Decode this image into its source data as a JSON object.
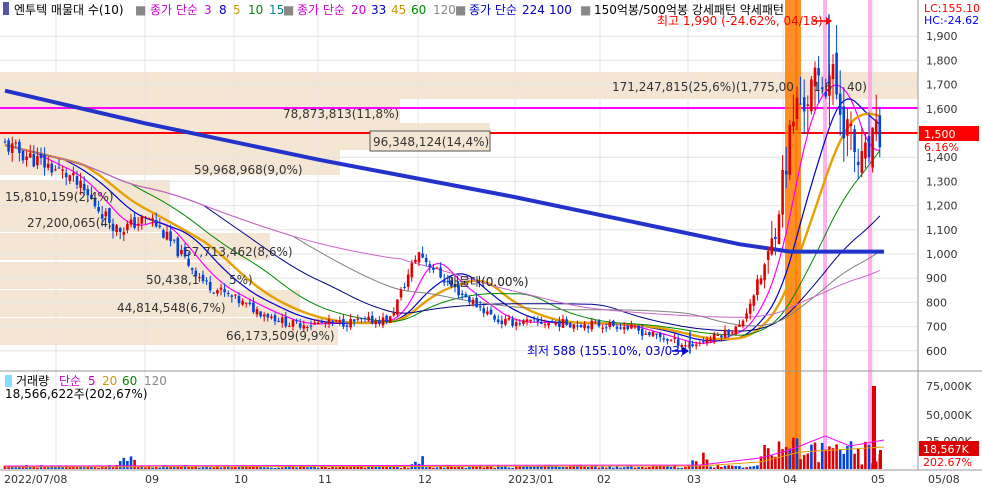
{
  "price_legend": {
    "stock": "엔투텍 매물대 수(10)",
    "ma_group1": "종가 단순",
    "ma_group1_periods": [
      "3",
      "8",
      "5",
      "10",
      "15"
    ],
    "ma_group2": "종가 단순",
    "ma_group2_periods": [
      "20",
      "33",
      "45",
      "60",
      "120"
    ],
    "ma_group3": "종가 단순",
    "ma_group3_periods": [
      "224",
      "100"
    ],
    "pattern": "150억봉/500억봉 강세패턴 약세패턴"
  },
  "price_corner": {
    "lc": "LC:155.10",
    "hc": "HC:-24.62"
  },
  "annotations": {
    "high": "최고 1,990 (-24.62%, 04/18)",
    "low": "최저 588 (155.10%, 03/03)",
    "crosshair": "매물대(0.00%)",
    "current_price": "1,500",
    "current_change": "6.16%"
  },
  "volume_profile": [
    {
      "label": "171,247,815(25,6%)(1,775,00",
      "suffix": "1,6",
      "suffix2": "40)"
    },
    {
      "label": "78,873,813(11,8%)"
    },
    {
      "label": "96,348,124(14,4%)"
    },
    {
      "label": "59,968,968(9,0%)"
    },
    {
      "label": "15,810,159(2,4%)"
    },
    {
      "label": "27,200,065(4,"
    },
    {
      "label": "57,713,462(8,6%)"
    },
    {
      "label": "50,438,1",
      "suffix": "5%)"
    },
    {
      "label": "44,814,548(6,7%)"
    },
    {
      "label": "66,173,509(9,9%)"
    }
  ],
  "price_axis": [
    "1,900",
    "1,800",
    "1,700",
    "1,600",
    "1,500",
    "1,400",
    "1,300",
    "1,200",
    "1,100",
    "1,000",
    "900",
    "800",
    "700",
    "600"
  ],
  "volume_legend": {
    "title": "거래량",
    "ma": "단순",
    "periods": [
      "5",
      "20",
      "60",
      "120"
    ],
    "current": "18,566,622주(202,67%)"
  },
  "volume_axis": [
    "75,000K",
    "50,000K",
    "25,000K"
  ],
  "volume_badge": {
    "value": "18,567K",
    "pct": "202.67%"
  },
  "date_axis": [
    "2022/07/08",
    "09",
    "10",
    "11",
    "12",
    "2023/01",
    "02",
    "03",
    "04",
    "05",
    "05/08"
  ],
  "colors": {
    "price_line": "#0000ff",
    "rising": "#e00000",
    "falling": "#0044dd",
    "ma224": "#2233cc",
    "magenta_line": "#ff00ff",
    "red_line": "#ff0000",
    "profile_bg": "#f5e6d3",
    "volume_badge": "#dd0000"
  },
  "chart_data": {
    "type": "candlestick",
    "x": [
      "2022/07/08",
      "09",
      "10",
      "11",
      "12",
      "2023/01",
      "02",
      "03",
      "04",
      "05",
      "05/08"
    ],
    "ylim": [
      550,
      2000
    ],
    "close_path": [
      {
        "x": "2022/07/08",
        "y": 1450
      },
      {
        "x": "2022/08",
        "y": 1320
      },
      {
        "x": "2022/08",
        "y": 1100
      },
      {
        "x": "2022/09",
        "y": 1150
      },
      {
        "x": "2022/09",
        "y": 880
      },
      {
        "x": "2022/10",
        "y": 780
      },
      {
        "x": "2022/10",
        "y": 710
      },
      {
        "x": "2022/11",
        "y": 715
      },
      {
        "x": "2022/11",
        "y": 730
      },
      {
        "x": "2022/12",
        "y": 1010
      },
      {
        "x": "2022/12",
        "y": 870
      },
      {
        "x": "2023/01",
        "y": 720
      },
      {
        "x": "2023/01",
        "y": 715
      },
      {
        "x": "2023/02",
        "y": 705
      },
      {
        "x": "2023/03",
        "y": 620
      },
      {
        "x": "2023/03",
        "y": 700
      },
      {
        "x": "2023/04",
        "y": 1000
      },
      {
        "x": "2023/04",
        "y": 1600
      },
      {
        "x": "2023/04",
        "y": 1750
      },
      {
        "x": "2023/05",
        "y": 1350
      },
      {
        "x": "05/08",
        "y": 1500
      }
    ],
    "ma224": [
      {
        "x": "2022/07/08",
        "y": 1675
      },
      {
        "x": "2022/09",
        "y": 1540
      },
      {
        "x": "2022/11",
        "y": 1390
      },
      {
        "x": "2023/01",
        "y": 1235
      },
      {
        "x": "2023/03",
        "y": 1040
      },
      {
        "x": "2023/04",
        "y": 1010
      },
      {
        "x": "05/08",
        "y": 1010
      }
    ],
    "high": 1990,
    "low": 588,
    "current": 1500
  }
}
